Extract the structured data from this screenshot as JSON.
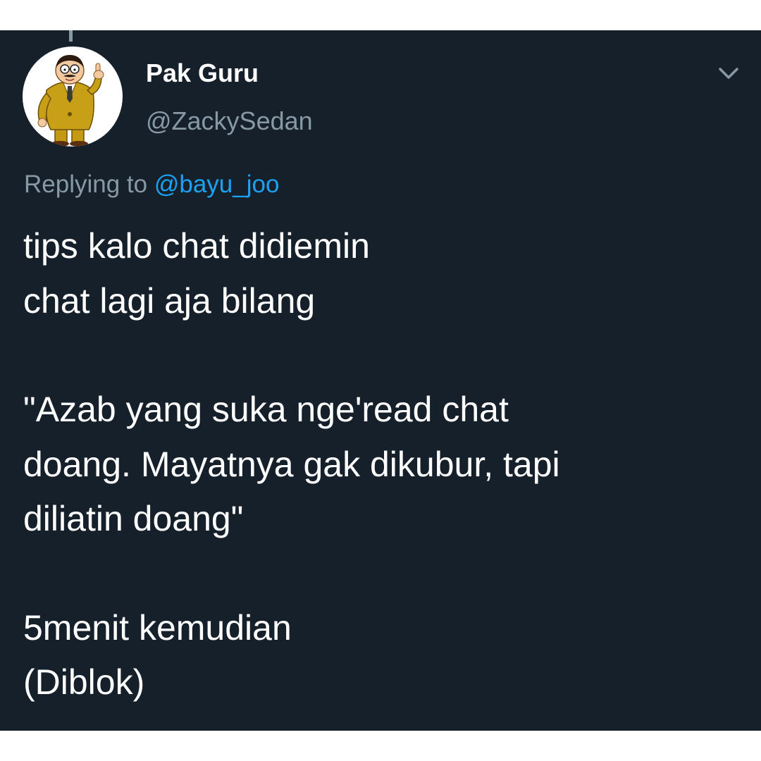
{
  "tweet": {
    "author": {
      "display_name": "Pak Guru",
      "handle": "@ZackySedan",
      "avatar_icon": "cartoon-teacher-avatar"
    },
    "menu_icon": "chevron-down-icon",
    "reply_context": {
      "prefix": "Replying to",
      "mention": "@bayu_joo"
    },
    "body": {
      "para1": {
        "line1": "tips kalo chat didiemin",
        "line2": "chat lagi aja bilang"
      },
      "para2": {
        "line1": "\"Azab yang suka nge'read chat",
        "line2": "doang. Mayatnya gak dikubur, tapi",
        "line3": "diliatin doang\""
      },
      "para3": {
        "line1": "5menit kemudian",
        "line2": "(Diblok)"
      }
    }
  },
  "colors": {
    "background": "#15202b",
    "primary_text": "#ffffff",
    "secondary_text": "#8899a6",
    "link": "#1da1f2",
    "frame": "#ffffff"
  }
}
